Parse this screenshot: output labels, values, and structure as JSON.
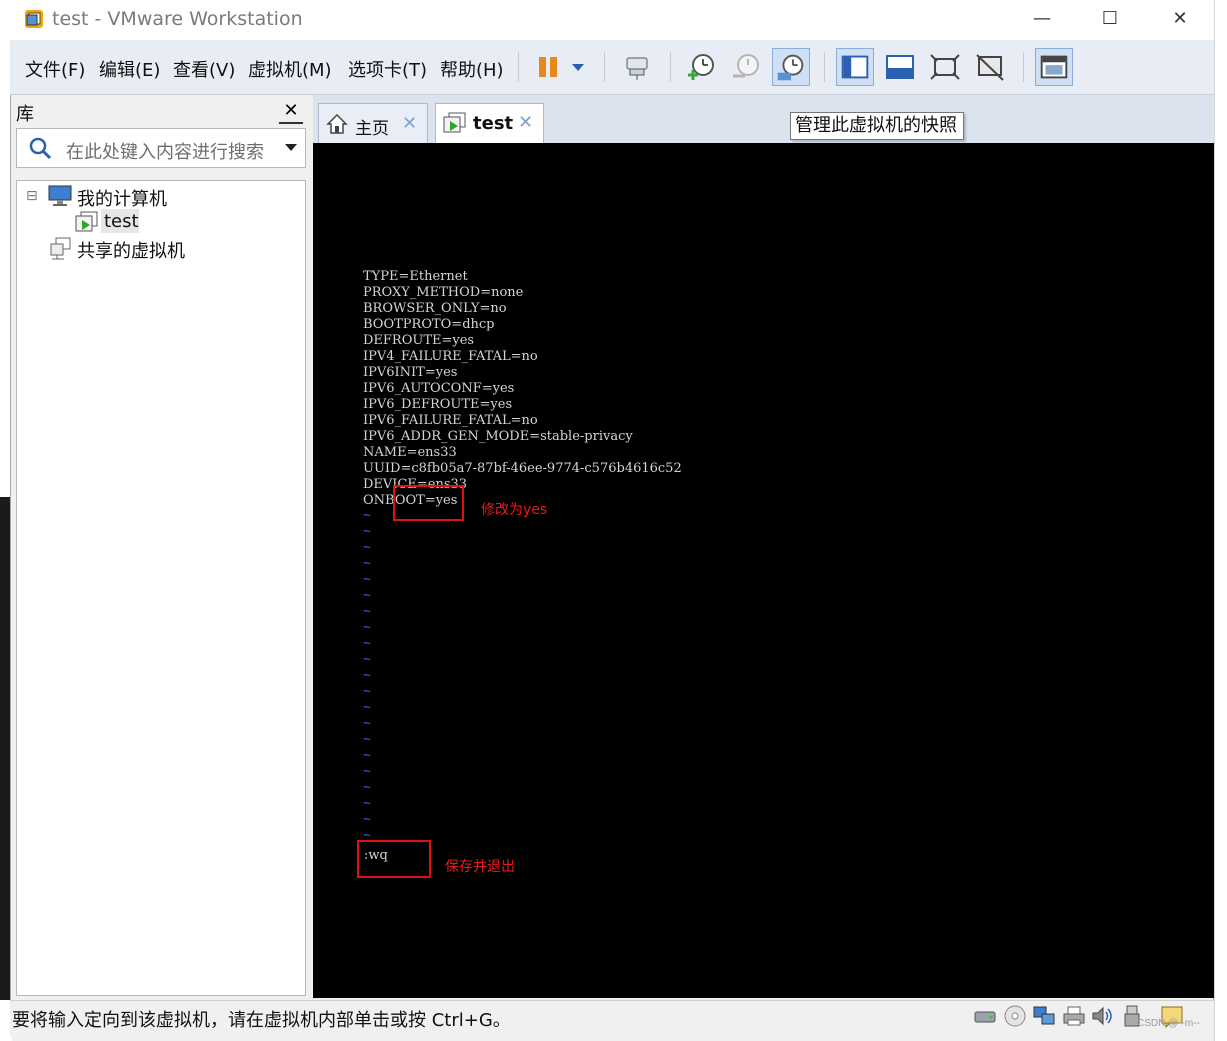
{
  "window": {
    "title": "test - VMware Workstation",
    "controls": {
      "minimize": "—",
      "maximize": "☐",
      "close": "✕"
    }
  },
  "menu": {
    "items": [
      "文件(F)",
      "编辑(E)",
      "查看(V)",
      "虚拟机(M)",
      "选项卡(T)",
      "帮助(H)"
    ]
  },
  "toolbar": {
    "icons": [
      "pause-icon",
      "dropdown-arrow-icon",
      "send-ctrl-alt-del-icon",
      "take-snapshot-icon",
      "revert-snapshot-icon",
      "snapshot-manager-icon",
      "show-library-icon",
      "thumbnail-bar-icon",
      "full-screen-icon",
      "unity-icon",
      "console-view-icon"
    ],
    "tooltip": "管理此虚拟机的快照"
  },
  "library": {
    "title": "库",
    "close_glyph": "✕",
    "search_placeholder": "在此处键入内容进行搜索",
    "tree": [
      {
        "label": "我的计算机",
        "icon": "computer-icon",
        "expander": "⊟"
      },
      {
        "label": "test",
        "icon": "vm-icon"
      },
      {
        "label": "共享的虚拟机",
        "icon": "shared-vm-icon"
      }
    ]
  },
  "tabs": [
    {
      "label": "主页",
      "icon": "home-icon",
      "close": "✕"
    },
    {
      "label": "test",
      "icon": "vm-icon",
      "close": "✕"
    }
  ],
  "console": {
    "lines": [
      "TYPE=Ethernet",
      "PROXY_METHOD=none",
      "BROWSER_ONLY=no",
      "BOOTPROTO=dhcp",
      "DEFROUTE=yes",
      "IPV4_FAILURE_FATAL=no",
      "IPV6INIT=yes",
      "IPV6_AUTOCONF=yes",
      "IPV6_DEFROUTE=yes",
      "IPV6_FAILURE_FATAL=no",
      "IPV6_ADDR_GEN_MODE=stable-privacy",
      "NAME=ens33",
      "UUID=c8fb05a7-87bf-46ee-9774-c576b4616c52",
      "DEVICE=ens33",
      "ONBOOT=yes"
    ],
    "tilde": "~",
    "tilde_count": 21,
    "command": ":wq",
    "annotations": {
      "onboot_note": "修改为yes",
      "save_note": "保存并退出"
    },
    "colors": {
      "text": "#d4d4d4",
      "tilde": "#4f4fff",
      "annotation": "#e01010"
    }
  },
  "statusbar": {
    "message": "要将输入定向到该虚拟机，请在虚拟机内部单击或按 Ctrl+G。",
    "icons": [
      "hard-disk-icon",
      "cd-dvd-icon",
      "network-adapter-icon",
      "printer-icon",
      "sound-card-icon",
      "usb-icon",
      "message-log-icon"
    ],
    "watermark": "CSDN @--m--"
  }
}
